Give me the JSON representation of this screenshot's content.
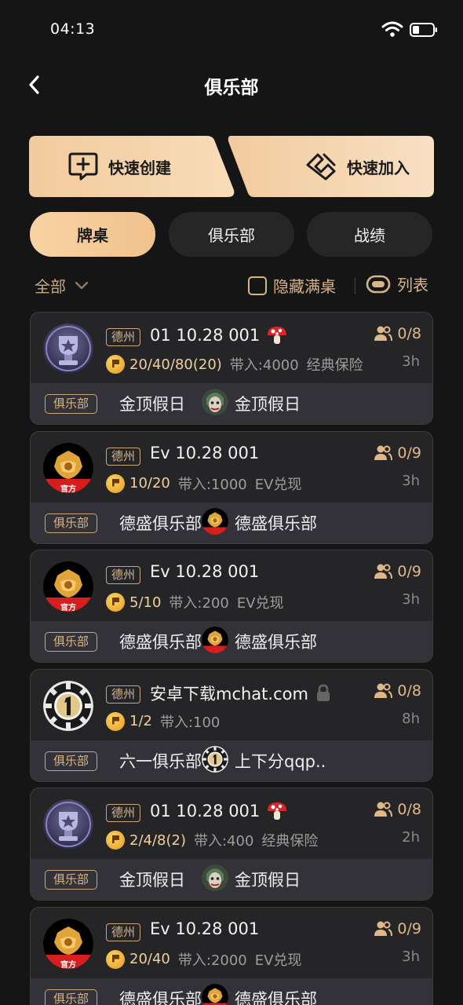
{
  "status_bar": {
    "time": "04:13",
    "icons": [
      "wifi-icon",
      "battery-icon"
    ]
  },
  "header": {
    "title": "俱乐部",
    "back_icon": "chevron-left-icon"
  },
  "actions": {
    "create_label": "快速创建",
    "create_icon": "plus-chat-icon",
    "join_label": "快速加入",
    "join_icon": "handshake-icon"
  },
  "tabs": [
    {
      "label": "牌桌",
      "active": true
    },
    {
      "label": "俱乐部",
      "active": false
    },
    {
      "label": "战绩",
      "active": false
    }
  ],
  "filters": {
    "all_label": "全部",
    "hide_full_label": "隐藏满桌",
    "hide_full_checked": false,
    "list_label": "列表"
  },
  "tables": [
    {
      "region": "德州",
      "name": "01 10.28 001",
      "name_icon": "mushroom-icon",
      "blinds": "20/40/80(20)",
      "buyin": "带入:4000",
      "mode": "经典保险",
      "seats": "0/8",
      "time": "3h",
      "club_tag": "俱乐部",
      "club": "金顶假日",
      "owner": "金顶假日",
      "avatar": "trophy",
      "owner_avatar": "joker"
    },
    {
      "region": "德州",
      "name": "Ev 10.28 001",
      "name_icon": "",
      "blinds": "10/20",
      "buyin": "带入:1000",
      "mode": "EV兑现",
      "seats": "0/9",
      "time": "3h",
      "club_tag": "俱乐部",
      "club": "德盛俱乐部",
      "owner": "德盛俱乐部",
      "avatar": "official",
      "owner_avatar": "official",
      "avatar_badge": "官方"
    },
    {
      "region": "德州",
      "name": "Ev 10.28 001",
      "name_icon": "",
      "blinds": "5/10",
      "buyin": "带入:200",
      "mode": "EV兑现",
      "seats": "0/9",
      "time": "3h",
      "club_tag": "俱乐部",
      "club": "德盛俱乐部",
      "owner": "德盛俱乐部",
      "avatar": "official",
      "owner_avatar": "official",
      "avatar_badge": "官方"
    },
    {
      "region": "德州",
      "name": "安卓下载mchat.com",
      "name_icon": "lock-icon",
      "blinds": "1/2",
      "buyin": "带入:100",
      "mode": "",
      "seats": "0/8",
      "time": "8h",
      "club_tag": "俱乐部",
      "club": "六一俱乐部",
      "owner": "上下分qqp..",
      "avatar": "chip",
      "owner_avatar": "chip"
    },
    {
      "region": "德州",
      "name": "01 10.28 001",
      "name_icon": "mushroom-icon",
      "blinds": "2/4/8(2)",
      "buyin": "带入:400",
      "mode": "经典保险",
      "seats": "0/8",
      "time": "2h",
      "club_tag": "俱乐部",
      "club": "金顶假日",
      "owner": "金顶假日",
      "avatar": "trophy",
      "owner_avatar": "joker"
    },
    {
      "region": "德州",
      "name": "Ev 10.28 001",
      "name_icon": "",
      "blinds": "20/40",
      "buyin": "带入:2000",
      "mode": "EV兑现",
      "seats": "0/9",
      "time": "3h",
      "club_tag": "俱乐部",
      "club": "德盛俱乐部",
      "owner": "德盛俱乐部",
      "avatar": "official",
      "owner_avatar": "official",
      "avatar_badge": "官方"
    }
  ],
  "colors": {
    "background": "#151515",
    "accent": "#f5c993",
    "gold_text": "#d8b587",
    "card": "#252528",
    "card_footer": "#333239"
  }
}
